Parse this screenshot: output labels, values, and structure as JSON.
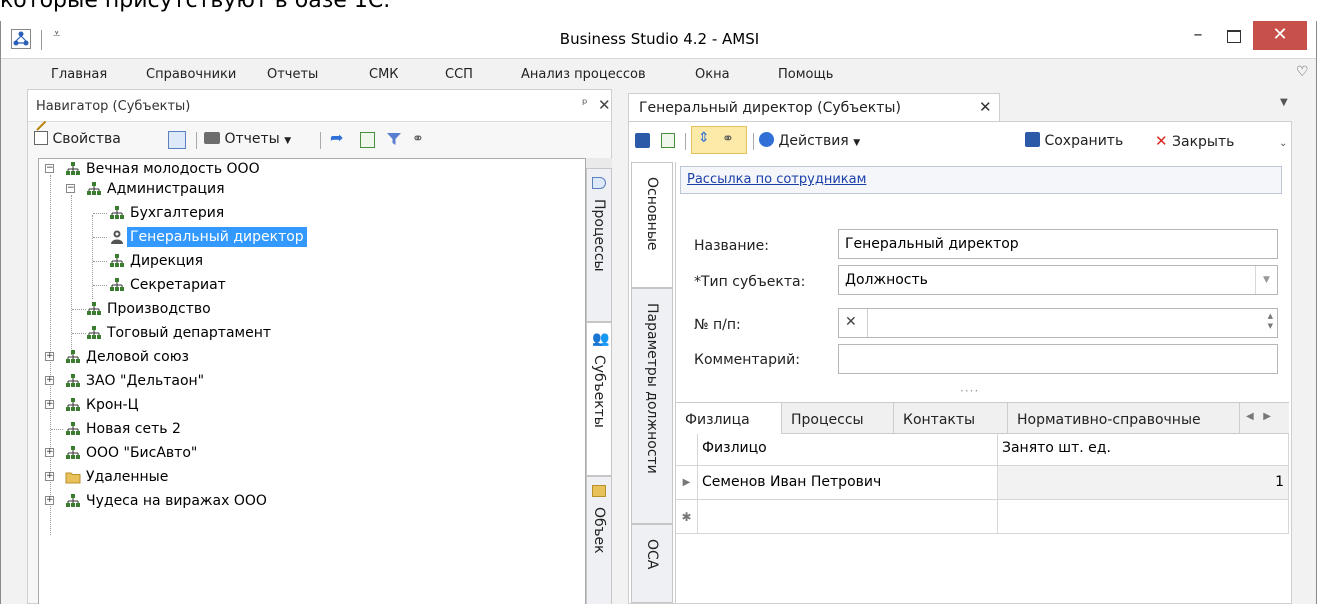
{
  "caption_top": "которые присутствуют в базе 1С.",
  "window": {
    "title": "Business Studio 4.2 - AMSI",
    "minimize": "–",
    "close": "✕"
  },
  "menu": [
    "Главная",
    "Справочники",
    "Отчеты",
    "СМК",
    "ССП",
    "Анализ процессов",
    "Окна",
    "Помощь"
  ],
  "navigator": {
    "title": "Навигатор (Субъекты)",
    "pin": "ᵖ",
    "close": "✕",
    "toolbar": {
      "properties": "Свойства",
      "reports": "Отчеты"
    },
    "tree": [
      {
        "label": "Вечная молодость ООО",
        "level": 0,
        "expander": "−",
        "icon": "org"
      },
      {
        "label": "Администрация",
        "level": 1,
        "expander": "−",
        "icon": "org"
      },
      {
        "label": "Бухгалтерия",
        "level": 2,
        "icon": "org"
      },
      {
        "label": "Генеральный директор",
        "level": 2,
        "icon": "person",
        "selected": true
      },
      {
        "label": "Дирекция",
        "level": 2,
        "icon": "org"
      },
      {
        "label": "Секретариат",
        "level": 2,
        "icon": "org"
      },
      {
        "label": "Производство",
        "level": 1,
        "icon": "org"
      },
      {
        "label": "Тоговый департамент",
        "level": 1,
        "icon": "org"
      },
      {
        "label": "Деловой союз",
        "level": 0,
        "expander": "+",
        "icon": "org"
      },
      {
        "label": "ЗАО \"Дельтаон\"",
        "level": 0,
        "expander": "+",
        "icon": "org"
      },
      {
        "label": "Крон-Ц",
        "level": 0,
        "expander": "+",
        "icon": "org"
      },
      {
        "label": "Новая сеть 2",
        "level": 0,
        "icon": "org"
      },
      {
        "label": "ООО \"БисАвто\"",
        "level": 0,
        "expander": "+",
        "icon": "org"
      },
      {
        "label": "Удаленные",
        "level": 0,
        "expander": "+",
        "icon": "folder"
      },
      {
        "label": "Чудеса на виражах ООО",
        "level": 0,
        "expander": "+",
        "icon": "org"
      }
    ],
    "side_tabs": {
      "processes": "Процессы",
      "subjects": "Субъекты",
      "objects": "Объек"
    }
  },
  "document": {
    "tab_label": "Генеральный директор (Субъекты)",
    "tab_close": "✕",
    "toolbar": {
      "actions": "Действия",
      "save": "Сохранить",
      "close": "Закрыть"
    },
    "side_tabs": {
      "main": "Основные",
      "position_params": "Параметры должности",
      "abc": "ОСА"
    },
    "mailing_link": "Рассылка по сотрудникам",
    "fields": {
      "name_label": "Название:",
      "name_value": "Генеральный директор",
      "type_label": "*Тип субъекта:",
      "type_value": "Должность",
      "num_label": "№ п/п:",
      "num_clear": "✕",
      "comment_label": "Комментарий:"
    },
    "grid_tabs": [
      "Физлица",
      "Процессы",
      "Контакты",
      "Нормативно-справочные"
    ],
    "grid": {
      "columns": [
        "Физлицо",
        "Занято шт. ед."
      ],
      "rows": [
        {
          "person": "Семенов Иван Петрович",
          "units": "1"
        }
      ]
    }
  }
}
